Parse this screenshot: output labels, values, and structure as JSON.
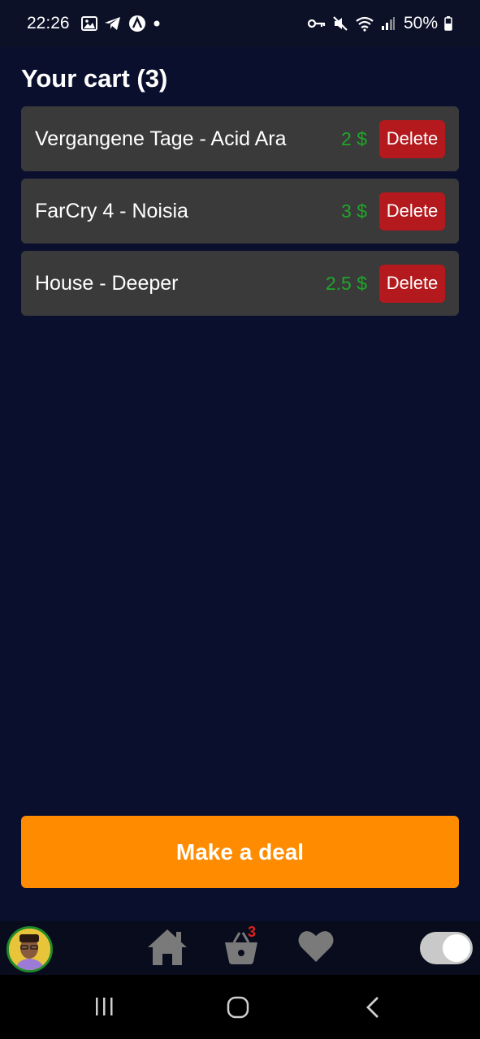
{
  "status_bar": {
    "time": "22:26",
    "battery": "50%",
    "left_icons": [
      "gallery-icon",
      "telegram-icon",
      "app-a-icon",
      "dot-icon"
    ],
    "right_icons": [
      "vpn-key-icon",
      "mute-icon",
      "wifi-icon",
      "signal-icon",
      "battery-icon"
    ]
  },
  "page": {
    "title": "Your cart (3)"
  },
  "cart": {
    "items": [
      {
        "name": "Vergangene Tage - Acid Ara",
        "price": "2 $",
        "delete_label": "Delete"
      },
      {
        "name": "FarCry 4 - Noisia",
        "price": "3 $",
        "delete_label": "Delete"
      },
      {
        "name": "House - Deeper",
        "price": "2.5 $",
        "delete_label": "Delete"
      }
    ]
  },
  "actions": {
    "deal_label": "Make a deal"
  },
  "bottom_nav": {
    "cart_badge": "3",
    "toggle_on": true,
    "items": [
      "home-icon",
      "cart-icon",
      "heart-icon"
    ]
  },
  "colors": {
    "background": "#0a0f2d",
    "card": "#3a3a3a",
    "price": "#1fa62a",
    "delete": "#b3191d",
    "accent": "#ff8c00"
  }
}
